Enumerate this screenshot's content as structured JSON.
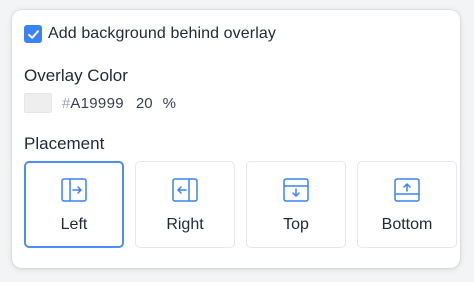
{
  "checkbox": {
    "label": "Add background behind overlay",
    "checked": true,
    "accent_color": "#3b82f6"
  },
  "overlay_color": {
    "title": "Overlay Color",
    "swatch_color": "#eeeeee",
    "hash": "#",
    "hex": "A19999",
    "opacity": "20",
    "percent_sign": "%"
  },
  "placement": {
    "title": "Placement",
    "selected": "Left",
    "options": [
      {
        "label": "Left",
        "icon": "placement-left-icon"
      },
      {
        "label": "Right",
        "icon": "placement-right-icon"
      },
      {
        "label": "Top",
        "icon": "placement-top-icon"
      },
      {
        "label": "Bottom",
        "icon": "placement-bottom-icon"
      }
    ]
  }
}
